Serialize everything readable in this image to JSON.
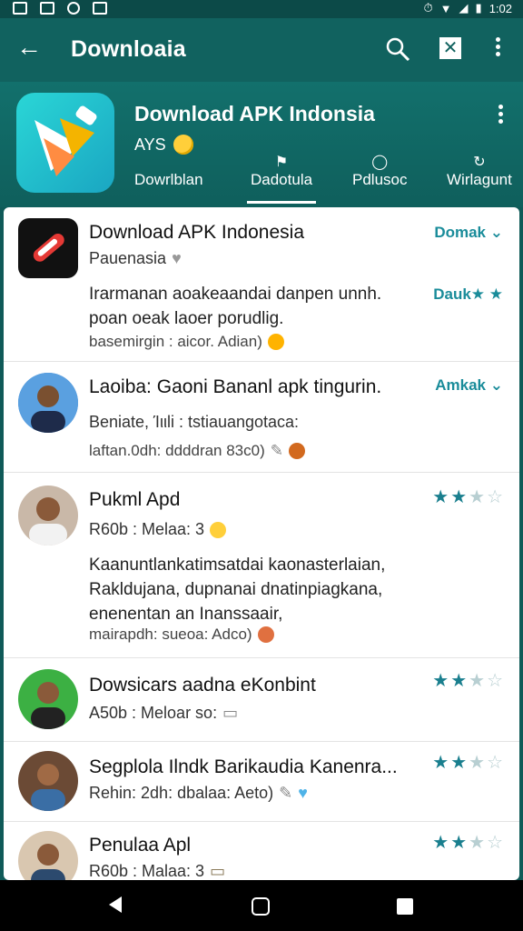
{
  "status": {
    "time": "1:02"
  },
  "toolbar": {
    "title": "Downloaia"
  },
  "app": {
    "title": "Download APK Indonsia",
    "developer": "AYS"
  },
  "tabs": [
    {
      "label": "Dowrlblan"
    },
    {
      "label": "Dadotula"
    },
    {
      "label": "Pdlusoc"
    },
    {
      "label": "Wirlagunt"
    }
  ],
  "items": [
    {
      "name": "Download APK Indonesia",
      "sub": "Pauenasia",
      "desc": [
        "Irarmanan aoakeaandai danpen unnh.",
        "poan oeak laoer porudlig."
      ],
      "meta": "basemirgin : aicor. Adian)",
      "tag": "Domak"
    },
    {
      "name": "Laoiba: Gaoni Bananl apk tingurin.",
      "sub": "Beniate, Ίιιli : tstiauangotaca:",
      "meta": "laftan.0dh: ddddran 83c0)",
      "tag": "Amkak"
    },
    {
      "name": "Pukml Apd",
      "sub": "R60b : Melaa: 3",
      "desc": [
        "Kaanuntlankatimsatdai kaonasterlaian,",
        "Rakldujana, dupnanai dnatinpiagkana,",
        "enenentan an Inanssaair,"
      ],
      "meta": "mairapdh: sueoa: Adco)"
    },
    {
      "name": "Dowsicars aadna eKonbint",
      "sub": "A50b : Meloar so:"
    },
    {
      "name": "Segplola Ilndk Barikaudia Kanenra...",
      "sub": "Rehin: 2dh: dbalaa: Aeto)"
    },
    {
      "name": "Penulaa Apl",
      "sub": "R60b : Malaa: 3"
    }
  ],
  "stars_label_extra": "Dauk★ ★"
}
